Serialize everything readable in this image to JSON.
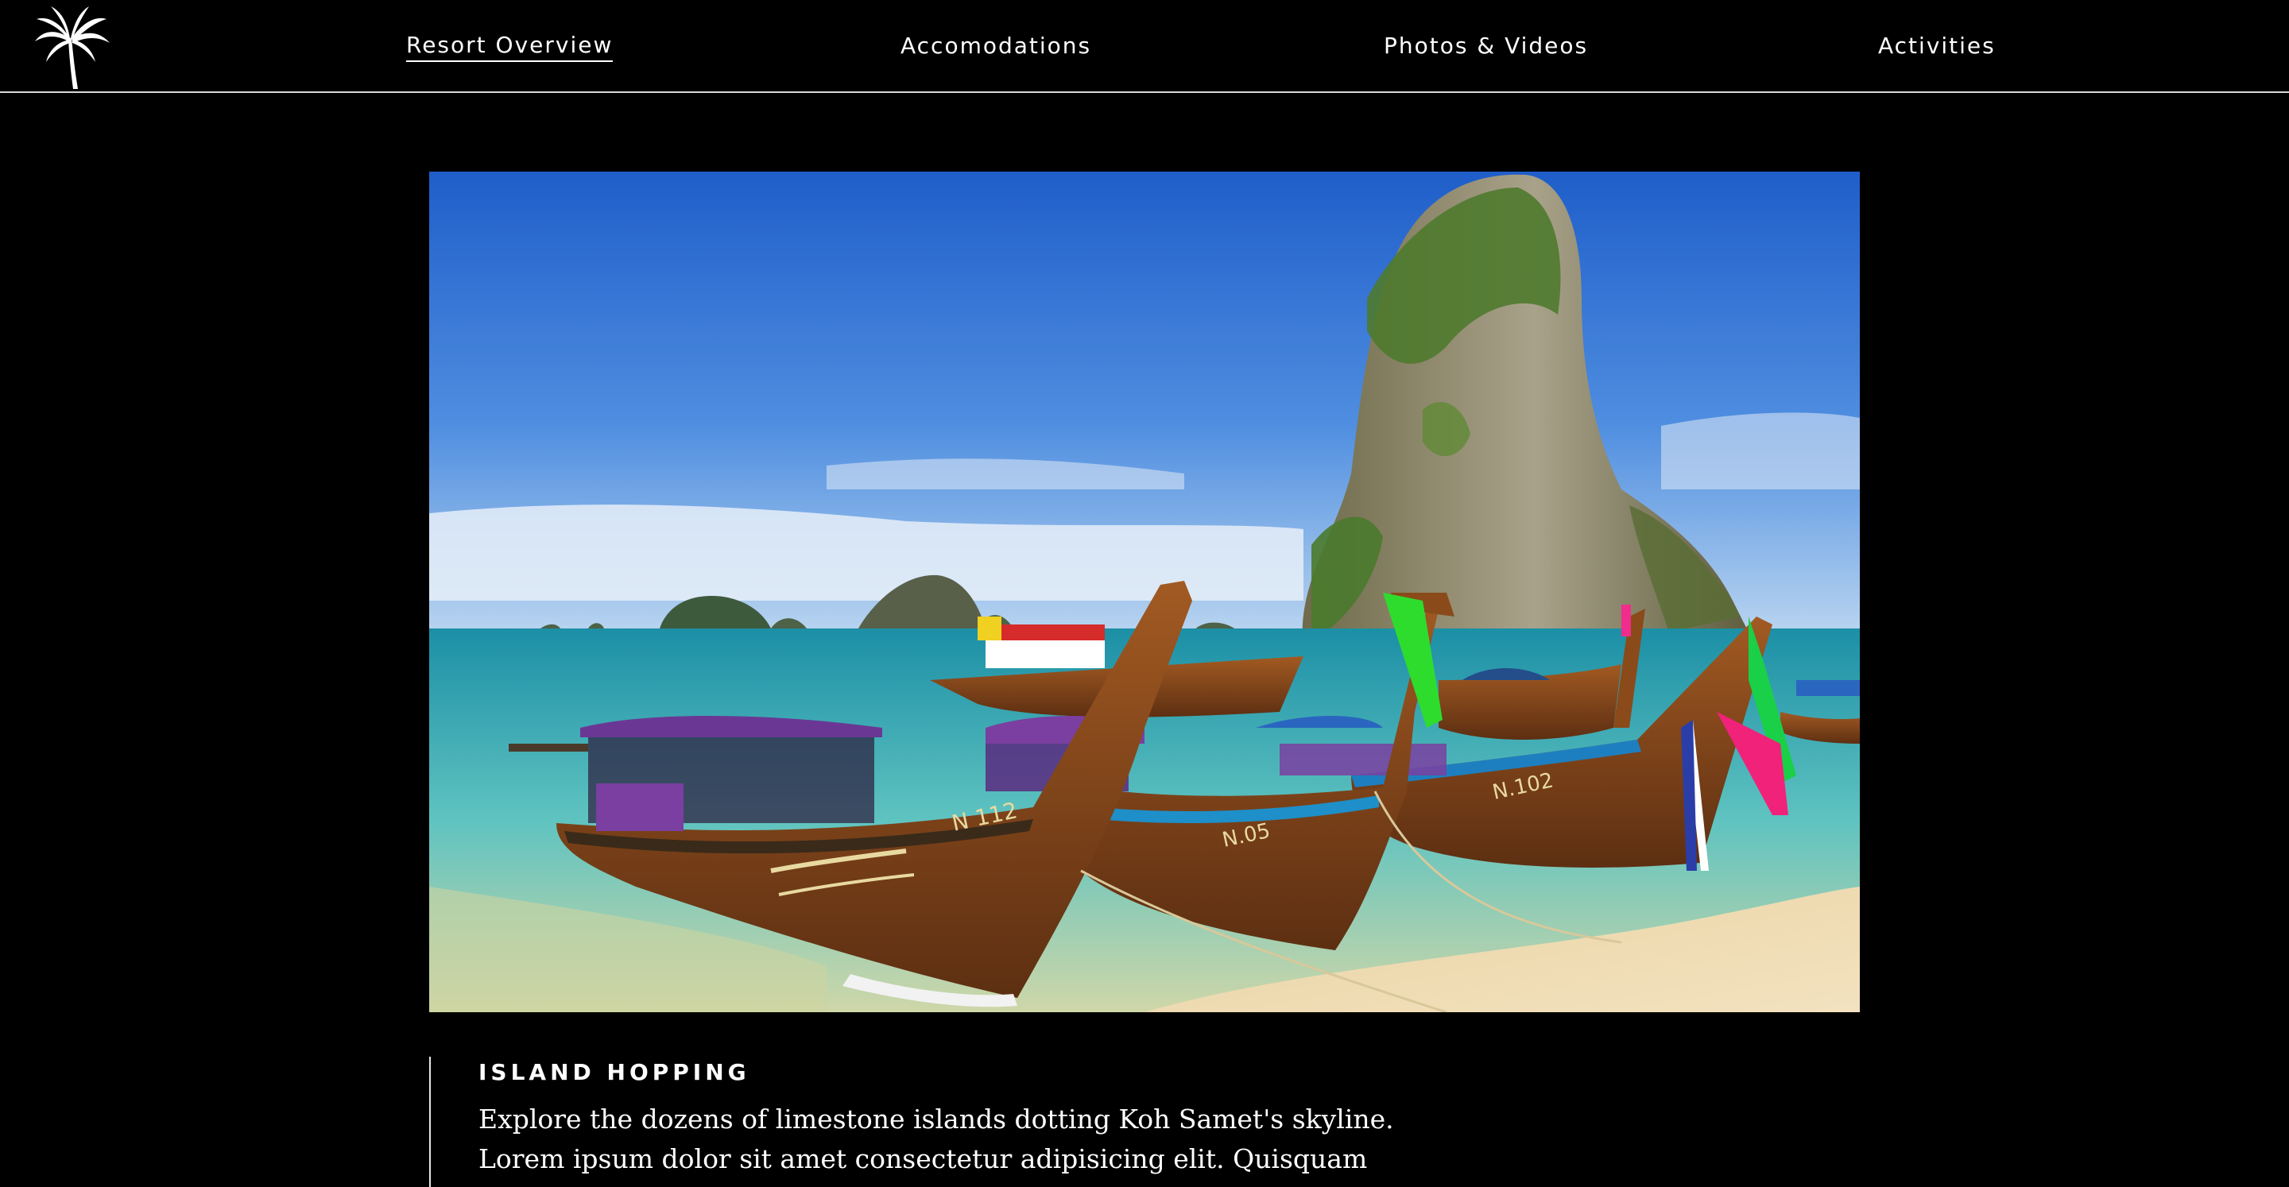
{
  "nav": {
    "logo_icon": "palm-tree-icon",
    "items": [
      {
        "label": "Resort Overview",
        "active": true
      },
      {
        "label": "Accomodations",
        "active": false
      },
      {
        "label": "Photos & Videos",
        "active": false
      },
      {
        "label": "Activities",
        "active": false
      }
    ]
  },
  "hero": {
    "image_subject": "longtail boats on beach with limestone islands",
    "boat_labels": [
      "N 112",
      "N.05",
      "N.102"
    ]
  },
  "feature": {
    "title": "ISLAND HOPPING",
    "lines": [
      "Explore the dozens of limestone islands dotting Koh Samet's skyline.",
      "Lorem ipsum dolor sit amet consectetur adipisicing elit. Quisquam"
    ]
  },
  "colors": {
    "background": "#000000",
    "text": "#ffffff",
    "divider": "#d9d9d9"
  }
}
